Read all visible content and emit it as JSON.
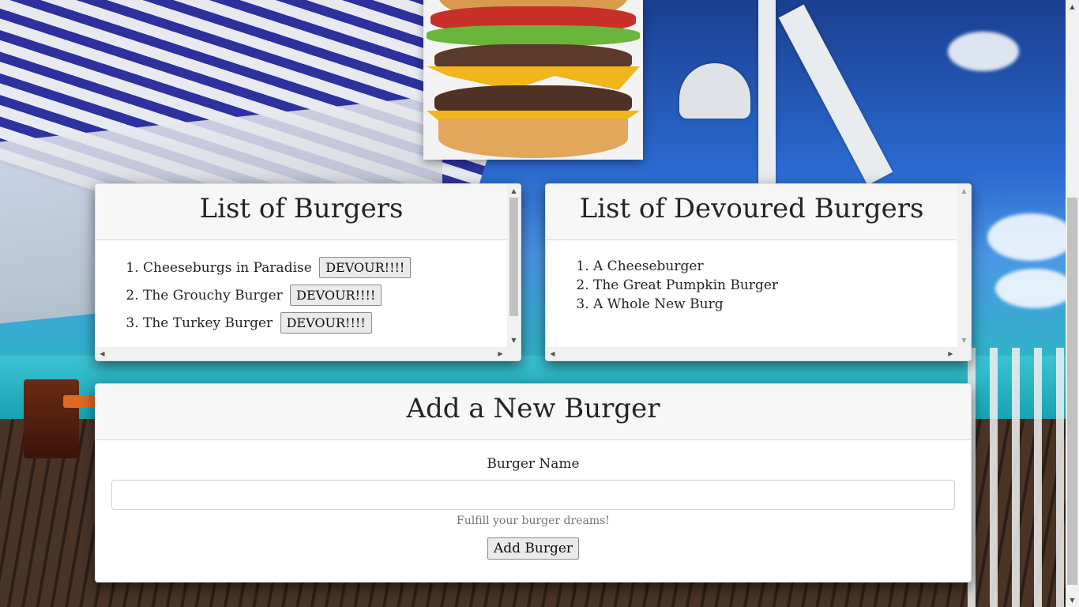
{
  "burger_list": {
    "title": "List of Burgers",
    "items": [
      {
        "name": "Cheeseburgs in Paradise",
        "button": "DEVOUR!!!!"
      },
      {
        "name": "The Grouchy Burger",
        "button": "DEVOUR!!!!"
      },
      {
        "name": "The Turkey Burger",
        "button": "DEVOUR!!!!"
      }
    ]
  },
  "devoured_list": {
    "title": "List of Devoured Burgers",
    "items": [
      "A Cheeseburger",
      "The Great Pumpkin Burger",
      "A Whole New Burg"
    ]
  },
  "add_form": {
    "title": "Add a New Burger",
    "label": "Burger Name",
    "input_value": "",
    "help": "Fulfill your burger dreams!",
    "submit": "Add Burger"
  },
  "icons": {
    "scroll_up": "arrow-up-icon",
    "scroll_down": "arrow-down-icon",
    "scroll_left": "arrow-left-icon",
    "scroll_right": "arrow-right-icon"
  }
}
